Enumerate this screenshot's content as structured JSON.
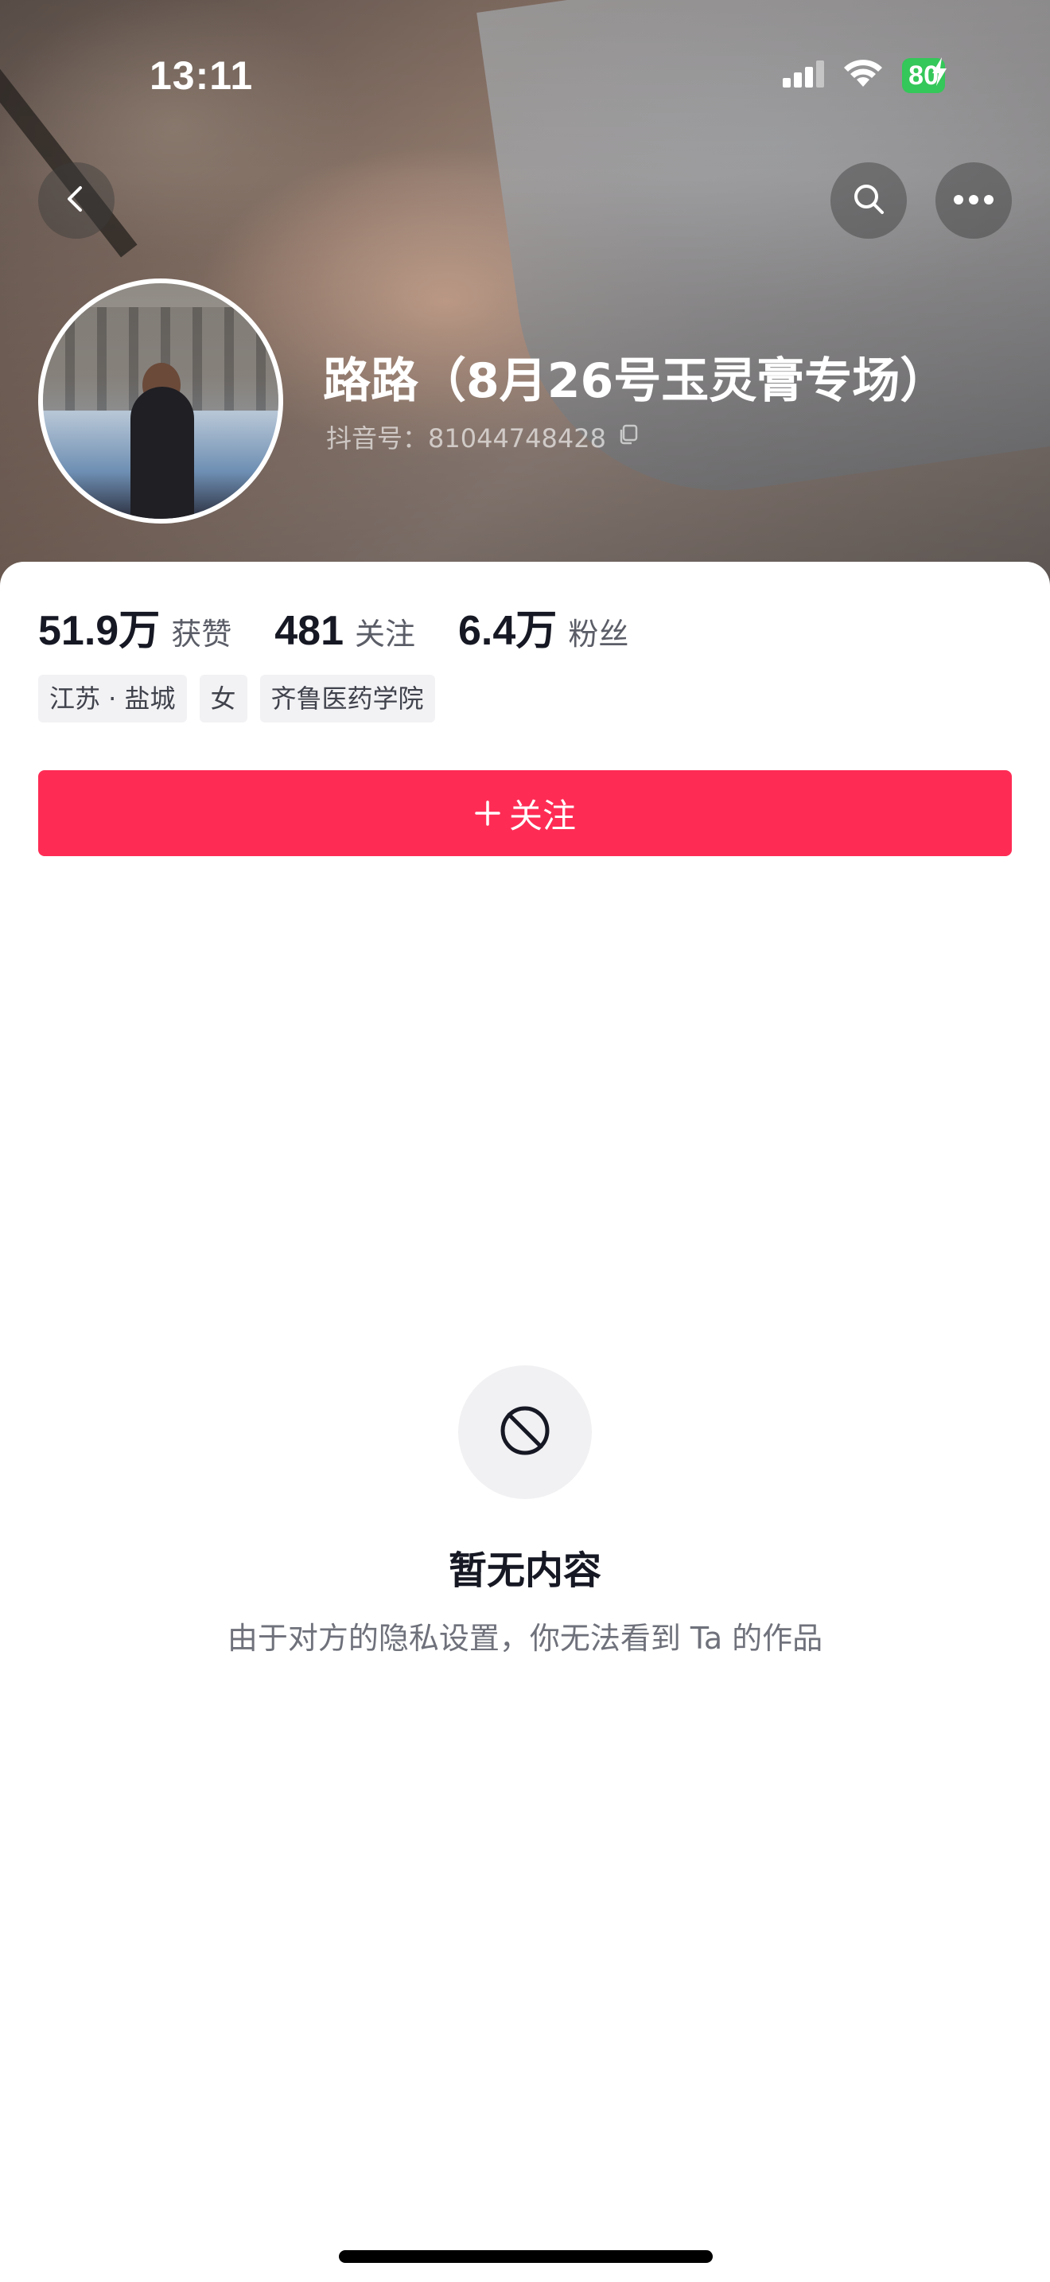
{
  "status_bar": {
    "time": "13:11",
    "battery": "80",
    "icons": [
      "signal-icon",
      "wifi-icon",
      "battery-icon"
    ]
  },
  "header": {
    "icons": {
      "back": "chevron-left-icon",
      "search": "search-icon",
      "more": "more-horizontal-icon"
    }
  },
  "profile": {
    "nickname": "路路（8月26号玉灵膏专场）",
    "douyin_id": "抖音号：81044748428",
    "stats": [
      {
        "value": "51.9万",
        "label": "获赞"
      },
      {
        "value": "481",
        "label": "关注"
      },
      {
        "value": "6.4万",
        "label": "粉丝"
      }
    ],
    "tags": [
      "江苏 · 盐城",
      "女",
      "齐鲁医药学院"
    ],
    "follow_label": "关注"
  },
  "empty_state": {
    "title": "暂无内容",
    "subtitle": "由于对方的隐私设置，你无法看到 Ta 的作品"
  },
  "colors": {
    "accent": "#fe2c55",
    "battery": "#34c759"
  }
}
